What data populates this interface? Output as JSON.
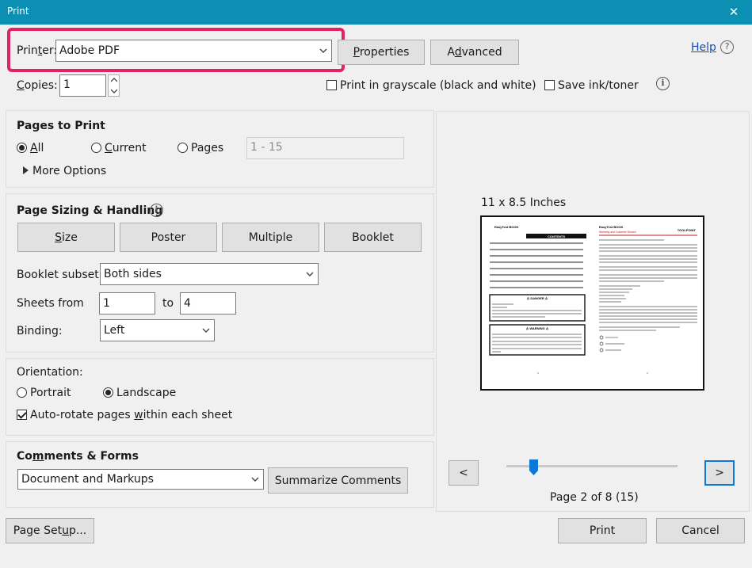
{
  "window": {
    "title": "Print",
    "close_glyph": "✕"
  },
  "printer": {
    "label_pre": "Prin",
    "label_ak": "t",
    "label_post": "er:",
    "value": "Adobe PDF"
  },
  "buttons": {
    "properties_ak": "P",
    "properties_rest": "roperties",
    "advanced_pre": "A",
    "advanced_ak": "d",
    "advanced_rest": "vanced",
    "help": "Help",
    "page_setup_pre": "Page Set",
    "page_setup_ak": "u",
    "page_setup_rest": "p...",
    "print": "Print",
    "cancel": "Cancel",
    "summarize": "Summarize Comments",
    "prev": "<",
    "next": ">"
  },
  "copies": {
    "label_ak": "C",
    "label_rest": "opies:",
    "value": "1"
  },
  "options": {
    "grayscale": {
      "label": "Print in grayscale (black and white)",
      "checked": false
    },
    "save_ink": {
      "label": "Save ink/toner",
      "checked": false
    }
  },
  "pages_to_print": {
    "heading": "Pages to Print",
    "all": {
      "ak": "A",
      "rest": "ll",
      "selected": true
    },
    "current": {
      "ak": "C",
      "rest": "urrent",
      "selected": false
    },
    "pages": {
      "pre": "Pa",
      "ak": "g",
      "rest": "es",
      "selected": false
    },
    "range": "1 - 15",
    "more_options": "More Options"
  },
  "page_sizing": {
    "heading": "Page Sizing & Handling",
    "tabs": {
      "size_ak": "S",
      "size_rest": "ize",
      "poster": "Poster",
      "multiple": "Multiple",
      "booklet": "Booklet"
    },
    "booklet_subset_label": "Booklet subset:",
    "booklet_subset_value": "Both sides",
    "sheets_from_label": "Sheets from",
    "sheets_from": "1",
    "to_label": "to",
    "sheets_to": "4",
    "binding_label": "Binding:",
    "binding_value": "Left"
  },
  "orientation": {
    "heading": "Orientation:",
    "portrait": {
      "label": "Portrait",
      "selected": false
    },
    "landscape": {
      "label": "Landscape",
      "selected": true
    },
    "autorotate": {
      "pre": "Auto-rotate pages ",
      "ak": "w",
      "rest": "ithin each sheet",
      "checked": true
    }
  },
  "comments_forms": {
    "heading_pre": "Co",
    "heading_ak": "m",
    "heading_rest": "ments & Forms",
    "value": "Document and Markups"
  },
  "preview": {
    "paper_size": "11 x 8.5 Inches",
    "page_status": "Page 2 of 8 (15)",
    "slider_position": 0.15,
    "left_page": {
      "header": "EasyTest BOOK",
      "toc_title": "CONTENTS",
      "box1_title": "⚠ DANGER ⚠",
      "box2_title": "⚠ WARNING ⚠"
    },
    "right_page": {
      "header": "EasyTest BOOK",
      "subheader": "Warranty and Customer Service",
      "logo": "TOOLPOINT"
    }
  },
  "icons": {
    "info": "info-icon",
    "help": "help-icon",
    "chevron": "chevron-down-icon",
    "triangle": "triangle-right-icon"
  }
}
